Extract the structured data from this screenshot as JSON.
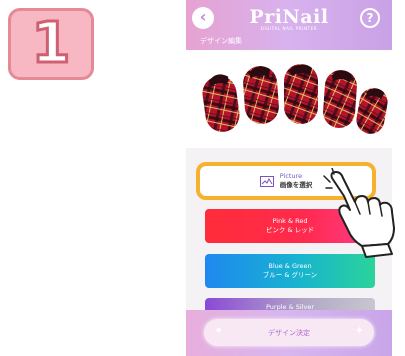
{
  "step": {
    "number": "1"
  },
  "app": {
    "name": "PriNail",
    "tagline": "DIGITAL NAIL PRINTER",
    "subtitle": "デザイン編集"
  },
  "header": {
    "back_icon": "chevron-left-icon",
    "help_label": "?"
  },
  "options": [
    {
      "title": "Picture",
      "subtitle": "画像を選択",
      "icon": "image-icon"
    },
    {
      "title": "Pink & Red",
      "subtitle": "ピンク & レッド"
    },
    {
      "title": "Blue & Green",
      "subtitle": "ブルー & グリーン"
    },
    {
      "title": "Purple & Silver"
    }
  ],
  "footer": {
    "confirm_label": "デザイン決定"
  },
  "colors": {
    "accent_pink": "#f7b8c3",
    "highlight": "#f6b12e",
    "header": "#d8b2ee",
    "plaid_red": "#b3142b"
  }
}
